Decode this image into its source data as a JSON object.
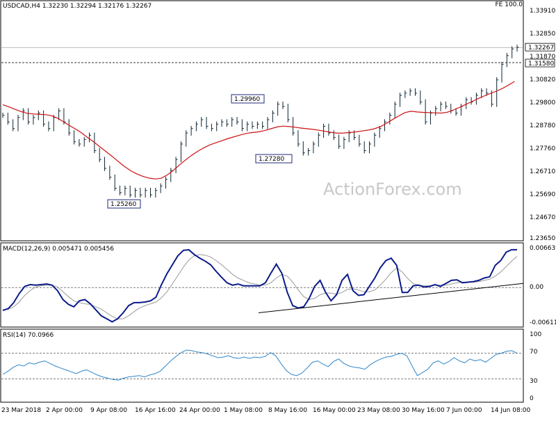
{
  "colors": {
    "price": "#0b2430",
    "ma": "#cc1111",
    "macd": "#0a1a8a",
    "signal": "#9a9a9a",
    "rsi": "#2e86c9",
    "grid": "#d8d8d8",
    "label_box": "#1f2a7a"
  },
  "watermark": "ActionForex.com",
  "chart_data": [
    {
      "type": "line",
      "title": "USDCAD,H4  1.32230 1.32294 1.32176 1.32267",
      "corner_label": "FE 100.0",
      "ylim": [
        1.2365,
        1.3391
      ],
      "yticks": [
        "1.33910",
        "1.32850",
        "1.31870",
        "1.30820",
        "1.29800",
        "1.28780",
        "1.27760",
        "1.26710",
        "1.25690",
        "1.24670",
        "1.23650"
      ],
      "price_tags": [
        {
          "label": "1.32267",
          "value": 1.32267
        },
        {
          "label": "1.31580",
          "value": 1.3158
        }
      ],
      "level_lines": [
        {
          "value": 1.3226,
          "style": "solid"
        },
        {
          "value": 1.3158,
          "style": "dashed"
        }
      ],
      "annotations": [
        {
          "label": "1.29960",
          "value": 1.2996,
          "date": "8 May"
        },
        {
          "label": "1.27280",
          "value": 1.2728,
          "date": "11 May"
        },
        {
          "label": "1.25260",
          "value": 1.2526,
          "date": "13 Apr"
        }
      ],
      "series": [
        {
          "values": [
            1.292,
            1.289,
            1.286,
            1.291,
            1.294,
            1.289,
            1.291,
            1.293,
            1.288,
            1.286,
            1.291,
            1.294,
            1.289,
            1.284,
            1.28,
            1.279,
            1.281,
            1.283,
            1.276,
            1.272,
            1.268,
            1.264,
            1.259,
            1.257,
            1.259,
            1.256,
            1.258,
            1.256,
            1.258,
            1.256,
            1.258,
            1.26,
            1.263,
            1.267,
            1.272,
            1.279,
            1.284,
            1.286,
            1.288,
            1.29,
            1.287,
            1.286,
            1.288,
            1.289,
            1.288,
            1.29,
            1.289,
            1.286,
            1.288,
            1.287,
            1.288,
            1.287,
            1.29,
            1.293,
            1.297,
            1.296,
            1.29,
            1.284,
            1.279,
            1.275,
            1.276,
            1.279,
            1.283,
            1.287,
            1.284,
            1.282,
            1.278,
            1.281,
            1.284,
            1.282,
            1.279,
            1.276,
            1.279,
            1.283,
            1.286,
            1.289,
            1.292,
            1.297,
            1.301,
            1.302,
            1.303,
            1.302,
            1.298,
            1.289,
            1.293,
            1.295,
            1.297,
            1.296,
            1.294,
            1.293,
            1.296,
            1.299,
            1.298,
            1.301,
            1.303,
            1.302,
            1.297,
            1.308,
            1.315,
            1.319,
            1.322,
            1.32267
          ]
        },
        {
          "values": [
            1.2968,
            1.2958,
            1.2947,
            1.2937,
            1.2929,
            1.2926,
            1.2924,
            1.2923,
            1.2918,
            1.2907,
            1.289,
            1.2873,
            1.2857,
            1.2839,
            1.2818,
            1.2798,
            1.2776,
            1.2755,
            1.2733,
            1.271,
            1.2688,
            1.2669,
            1.2655,
            1.2644,
            1.2636,
            1.2632,
            1.2635,
            1.265,
            1.2671,
            1.2695,
            1.2718,
            1.2739,
            1.2757,
            1.2773,
            1.2786,
            1.2796,
            1.2805,
            1.2815,
            1.2823,
            1.2831,
            1.2838,
            1.2842,
            1.2845,
            1.2851,
            1.2859,
            1.2867,
            1.2871,
            1.2869,
            1.2866,
            1.2862,
            1.2859,
            1.2856,
            1.2852,
            1.2847,
            1.2842,
            1.2839,
            1.284,
            1.2842,
            1.2845,
            1.2849,
            1.2853,
            1.2859,
            1.2869,
            1.2884,
            1.2901,
            1.2917,
            1.2932,
            1.2938,
            1.2935,
            1.2933,
            1.2932,
            1.2931,
            1.293,
            1.2934,
            1.2944,
            1.2956,
            1.2969,
            1.2982,
            1.2995,
            1.3007,
            1.3018,
            1.3029,
            1.3041,
            1.3056,
            1.3073
          ]
        }
      ]
    },
    {
      "type": "line",
      "title": "MACD(12,26,9) 0.005471 0.005456",
      "ylim": [
        -0.00611,
        0.00664
      ],
      "yticks": [
        "0.006639",
        "0.00",
        "-0.006114"
      ],
      "series": [
        {
          "values": [
            -0.0038,
            -0.0035,
            -0.0025,
            -0.001,
            0.0002,
            0.0005,
            0.0004,
            0.0005,
            0.0006,
            0.0004,
            -0.0005,
            -0.002,
            -0.0028,
            -0.0032,
            -0.0022,
            -0.002,
            -0.0027,
            -0.0037,
            -0.0047,
            -0.0052,
            -0.0057,
            -0.0052,
            -0.0042,
            -0.003,
            -0.0025,
            -0.0025,
            -0.0024,
            -0.0022,
            -0.0016,
            0.0005,
            0.0023,
            0.0038,
            0.0053,
            0.0062,
            0.0063,
            0.0055,
            0.0049,
            0.0044,
            0.0038,
            0.0027,
            0.0017,
            0.0008,
            0.0004,
            0.0006,
            0.0003,
            0.0003,
            0.0003,
            0.0003,
            0.0008,
            0.0024,
            0.0039,
            0.0024,
            -0.0008,
            -0.003,
            -0.0034,
            -0.0032,
            -0.0018,
            0.0002,
            0.0012,
            -0.0008,
            -0.0022,
            -0.0012,
            0.0012,
            0.0022,
            -0.0005,
            -0.0013,
            -0.0012,
            0.0002,
            0.0016,
            0.0033,
            0.0045,
            0.0049,
            0.0037,
            -0.0008,
            -0.0008,
            0.0003,
            0.0004,
            0.0001,
            0.0002,
            0.0005,
            0.0002,
            0.0007,
            0.0012,
            0.0013,
            0.0008,
            0.0009,
            0.001,
            0.0012,
            0.0016,
            0.0018,
            0.0037,
            0.0045,
            0.0059,
            0.0063,
            0.0063
          ]
        },
        {
          "values": [
            -0.0037,
            -0.0036,
            -0.0032,
            -0.0024,
            -0.0013,
            -0.0005,
            0.0001,
            0.0003,
            0.0004,
            0.0004,
            0.0001,
            -0.0007,
            -0.0015,
            -0.0022,
            -0.0025,
            -0.0027,
            -0.0028,
            -0.0032,
            -0.0036,
            -0.0042,
            -0.0048,
            -0.0052,
            -0.0052,
            -0.0047,
            -0.004,
            -0.0034,
            -0.003,
            -0.0027,
            -0.0024,
            -0.0017,
            -0.0007,
            0.0006,
            0.002,
            0.0034,
            0.0046,
            0.0053,
            0.0055,
            0.0054,
            0.0051,
            0.0045,
            0.0038,
            0.003,
            0.0022,
            0.0016,
            0.0012,
            0.0008,
            0.0006,
            0.0004,
            0.0004,
            0.0008,
            0.0016,
            0.0022,
            0.0019,
            0.0009,
            -0.0004,
            -0.0015,
            -0.002,
            -0.0018,
            -0.0012,
            -0.0009,
            -0.0009,
            -0.0011,
            -0.0008,
            -0.0003,
            -0.0002,
            -0.0004,
            -0.0007,
            -0.0007,
            -0.0004,
            0.0004,
            0.0014,
            0.0025,
            0.0033,
            0.0026,
            0.0015,
            0.0007,
            0.0004,
            0.0003,
            0.0003,
            0.0004,
            0.0004,
            0.0004,
            0.0006,
            0.0008,
            0.0009,
            0.0009,
            0.0009,
            0.001,
            0.0012,
            0.0014,
            0.0019,
            0.0026,
            0.0035,
            0.0044,
            0.0052
          ]
        }
      ],
      "trendline": {
        "from": -0.0042,
        "to": 0.0007
      }
    },
    {
      "type": "line",
      "title": "RSI(14) 70.0966",
      "ylim": [
        0,
        100
      ],
      "yticks": [
        "100",
        "70",
        "30",
        "0"
      ],
      "levels": [
        70,
        30
      ],
      "series": [
        {
          "values": [
            37,
            42,
            48,
            52,
            50,
            55,
            53,
            56,
            58,
            54,
            50,
            47,
            44,
            41,
            38,
            42,
            44,
            40,
            36,
            33,
            31,
            29,
            28,
            31,
            33,
            34,
            35,
            33,
            36,
            38,
            42,
            50,
            58,
            65,
            71,
            75,
            74,
            72,
            71,
            69,
            66,
            63,
            64,
            66,
            63,
            62,
            64,
            62,
            64,
            63,
            65,
            71,
            66,
            54,
            43,
            37,
            35,
            39,
            47,
            56,
            58,
            53,
            49,
            57,
            61,
            54,
            50,
            48,
            47,
            45,
            52,
            57,
            61,
            64,
            65,
            68,
            70,
            66,
            50,
            35,
            40,
            45,
            55,
            58,
            53,
            57,
            63,
            58,
            55,
            61,
            58,
            60,
            56,
            62,
            68,
            70,
            73,
            74,
            70
          ]
        }
      ]
    }
  ],
  "x_labels": [
    "23 Mar 2018",
    "2 Apr 00:00",
    "9 Apr 08:00",
    "16 Apr 16:00",
    "24 Apr 00:00",
    "1 May 08:00",
    "8 May 16:00",
    "16 May 00:00",
    "23 May 08:00",
    "30 May 16:00",
    "7 Jun 00:00",
    "14 Jun 08:00"
  ]
}
